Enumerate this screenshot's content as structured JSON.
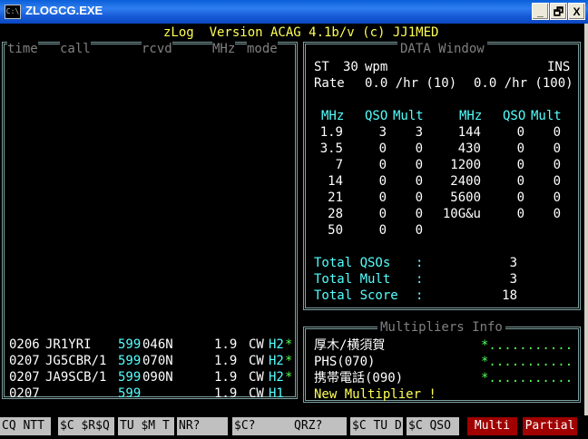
{
  "window": {
    "title": "ZLOGCG.EXE",
    "icon_label": "C:\\",
    "minimize": "_",
    "maximize": "🗗",
    "close": "X"
  },
  "header": {
    "title": "zLog  Version ACAG 4.1b/v (c) JJ1MED"
  },
  "log_panel": {
    "columns": [
      "time",
      "call",
      "rcvd",
      "MHz",
      "mode"
    ],
    "rows": [
      {
        "time": "0206",
        "call": "JR1YRI",
        "rst": "599",
        "num": "046N",
        "mhz": "1.9",
        "mode": "CW",
        "pwr": "H2",
        "star": "*"
      },
      {
        "time": "0207",
        "call": "JG5CBR/1",
        "rst": "599",
        "num": "070N",
        "mhz": "1.9",
        "mode": "CW",
        "pwr": "H2",
        "star": "*"
      },
      {
        "time": "0207",
        "call": "JA9SCB/1",
        "rst": "599",
        "num": "090N",
        "mhz": "1.9",
        "mode": "CW",
        "pwr": "H2",
        "star": "*"
      },
      {
        "time": "0207",
        "call": "",
        "rst": "599",
        "num": "",
        "mhz": "1.9",
        "mode": "CW",
        "pwr": "H1",
        "star": ""
      }
    ]
  },
  "data_window": {
    "title": "DATA Window",
    "st_label": "ST",
    "st_value": "30",
    "st_unit": "wpm",
    "mode_flag": "INS",
    "rate_label": "Rate",
    "rate1": "0.0 /hr (10)",
    "rate2": "0.0 /hr (100)",
    "col_mhz": "MHz",
    "col_qso": "QSO",
    "col_mult": "Mult",
    "bands_left": [
      {
        "mhz": "1.9",
        "qso": "3",
        "mult": "3"
      },
      {
        "mhz": "3.5",
        "qso": "0",
        "mult": "0"
      },
      {
        "mhz": "7",
        "qso": "0",
        "mult": "0"
      },
      {
        "mhz": "14",
        "qso": "0",
        "mult": "0"
      },
      {
        "mhz": "21",
        "qso": "0",
        "mult": "0"
      },
      {
        "mhz": "28",
        "qso": "0",
        "mult": "0"
      },
      {
        "mhz": "50",
        "qso": "0",
        "mult": "0"
      }
    ],
    "bands_right": [
      {
        "mhz": "144",
        "qso": "0",
        "mult": "0"
      },
      {
        "mhz": "430",
        "qso": "0",
        "mult": "0"
      },
      {
        "mhz": "1200",
        "qso": "0",
        "mult": "0"
      },
      {
        "mhz": "2400",
        "qso": "0",
        "mult": "0"
      },
      {
        "mhz": "5600",
        "qso": "0",
        "mult": "0"
      },
      {
        "mhz": "10G&u",
        "qso": "0",
        "mult": "0"
      }
    ],
    "totals": [
      {
        "label": "Total QSOs",
        "colon": ":",
        "value": "3"
      },
      {
        "label": "Total Mult",
        "colon": ":",
        "value": "3"
      },
      {
        "label": "Total Score",
        "colon": ":",
        "value": "18"
      }
    ]
  },
  "multipliers": {
    "title": "Multipliers Info",
    "items": [
      {
        "name": "厚木/横須賀",
        "marks": "*..........."
      },
      {
        "name": "PHS(070)",
        "marks": "*..........."
      },
      {
        "name": "携帯電話(090)",
        "marks": "*..........."
      }
    ],
    "new_label": "New Multiplier !"
  },
  "fkeys": [
    {
      "label": "CQ NTT",
      "color": "#c0c0c0"
    },
    {
      "label": "$C $R$Q",
      "color": "#c0c0c0"
    },
    {
      "label": "TU $M T",
      "color": "#c0c0c0"
    },
    {
      "label": "NR?",
      "color": "#c0c0c0"
    },
    {
      "label": "$C?",
      "color": "#c0c0c0"
    },
    {
      "label": "QRZ?",
      "color": "#c0c0c0"
    },
    {
      "label": "$C TU D",
      "color": "#c0c0c0"
    },
    {
      "label": "$C QSO",
      "color": "#c0c0c0"
    },
    {
      "label": "Multi",
      "color": "#a00000"
    },
    {
      "label": "Partial",
      "color": "#a00000"
    }
  ]
}
